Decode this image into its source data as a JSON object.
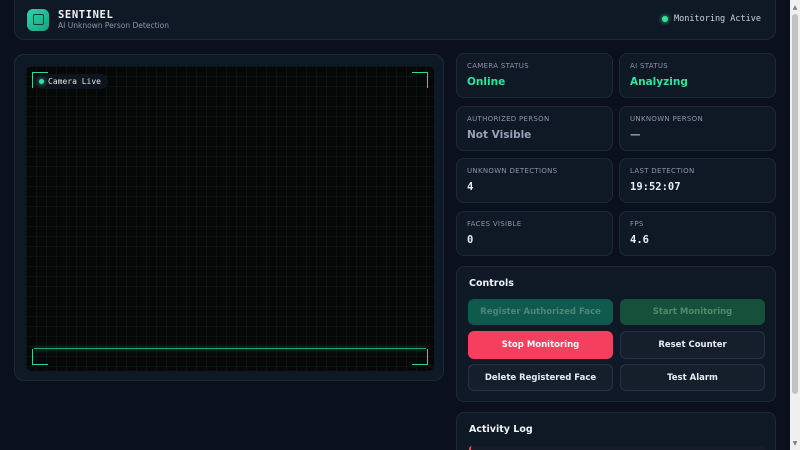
{
  "header": {
    "title": "SENTINEL",
    "subtitle": "AI Unknown Person Detection",
    "status": "Monitoring Active"
  },
  "camera": {
    "badge": "Camera Live"
  },
  "stats": [
    {
      "label": "CAMERA STATUS",
      "value": "Online"
    },
    {
      "label": "AI STATUS",
      "value": "Analyzing"
    },
    {
      "label": "AUTHORIZED PERSON",
      "value": "Not Visible"
    },
    {
      "label": "UNKNOWN PERSON",
      "value": "—"
    },
    {
      "label": "UNKNOWN DETECTIONS",
      "value": "4"
    },
    {
      "label": "LAST DETECTION",
      "value": "19:52:07"
    },
    {
      "label": "FACES VISIBLE",
      "value": "0"
    },
    {
      "label": "FPS",
      "value": "4.6"
    }
  ],
  "controls": {
    "title": "Controls",
    "register_face": "Register Authorized Face",
    "start_monitoring": "Start Monitoring",
    "stop_monitoring": "Stop Monitoring",
    "reset_counter": "Reset Counter",
    "delete_face": "Delete Registered Face",
    "test_alarm": "Test Alarm"
  },
  "activity": {
    "title": "Activity Log"
  },
  "colors": {
    "accent": "#2dd4aa",
    "live_dot": "#2ee59d",
    "danger": "#f43f5e",
    "background": "#0a111c"
  },
  "icons": [
    "sentinel-logo-icon",
    "status-dot-icon",
    "scroll-up-icon",
    "scroll-down-icon"
  ]
}
